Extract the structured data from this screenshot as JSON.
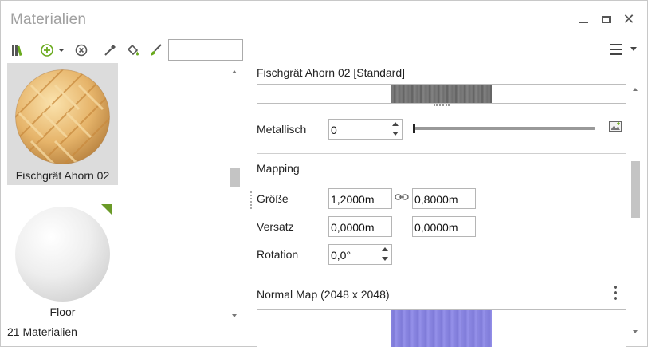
{
  "window": {
    "title": "Materialien",
    "controls": {
      "minimize": "minimize",
      "maximize": "maximize",
      "close": "✕"
    }
  },
  "toolbar": {
    "search": {
      "value": "",
      "placeholder": ""
    },
    "icons": [
      "library-icon",
      "add-circle-icon",
      "dropdown-caret-icon",
      "remove-circle-icon",
      "eyedropper-icon",
      "paint-bucket-icon",
      "brush-icon",
      "hamburger-menu-icon"
    ],
    "accent": "#6aaa1e"
  },
  "material_list": {
    "items": [
      {
        "name": "Fischgrät Ahorn 02",
        "selected": true
      },
      {
        "name": "Floor",
        "selected": false
      }
    ],
    "count_label": "21 Materialien"
  },
  "properties": {
    "material_title": "Fischgrät Ahorn 02 [Standard]",
    "metallic": {
      "label": "Metallisch",
      "value": "0",
      "slider_fraction": 0.0
    },
    "mapping": {
      "title": "Mapping",
      "size": {
        "label": "Größe",
        "x": "1,2000m",
        "y": "0,8000m"
      },
      "offset": {
        "label": "Versatz",
        "x": "0,0000m",
        "y": "0,0000m"
      },
      "rotation": {
        "label": "Rotation",
        "value": "0,0°"
      }
    },
    "normal_map": {
      "title": "Normal Map (2048 x 2048)"
    }
  },
  "colors": {
    "normal_map_tint": "#8c88e0",
    "texture_gray": "#7a7a7a",
    "wood_light": "#f3d49a",
    "wood_dark": "#d9a65a",
    "corner_badge": "#6a9a28"
  }
}
